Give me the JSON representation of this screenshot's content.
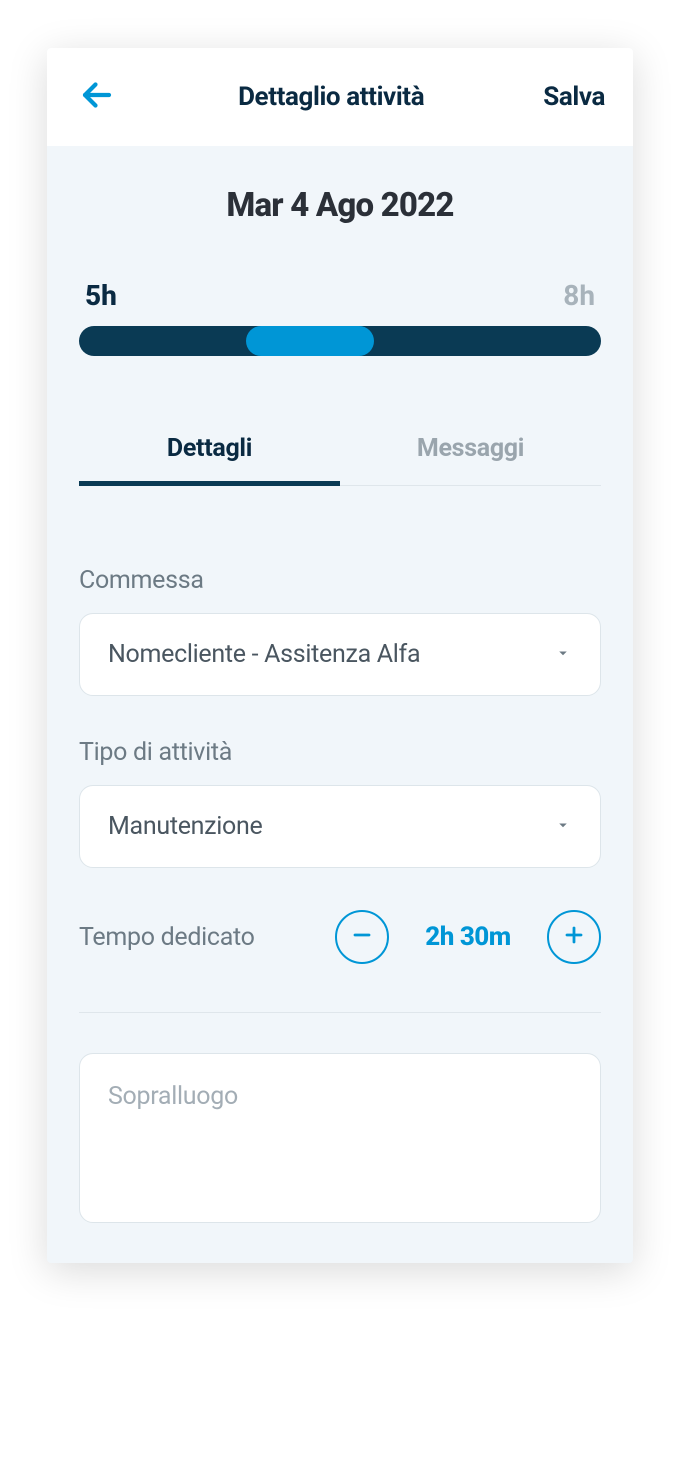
{
  "header": {
    "title": "Dettaglio attività",
    "save_label": "Salva"
  },
  "date": "Mar 4 Ago 2022",
  "hours": {
    "left": "5h",
    "right": "8h"
  },
  "tabs": {
    "details": "Dettagli",
    "messages": "Messaggi"
  },
  "form": {
    "commessa_label": "Commessa",
    "commessa_value": "Nomecliente - Assitenza Alfa",
    "tipo_label": "Tipo di attività",
    "tipo_value": "Manutenzione",
    "tempo_label": "Tempo dedicato",
    "tempo_value": "2h 30m",
    "notes_placeholder": "Sopralluogo"
  },
  "colors": {
    "accent": "#0096d6",
    "dark": "#0a3a54"
  }
}
